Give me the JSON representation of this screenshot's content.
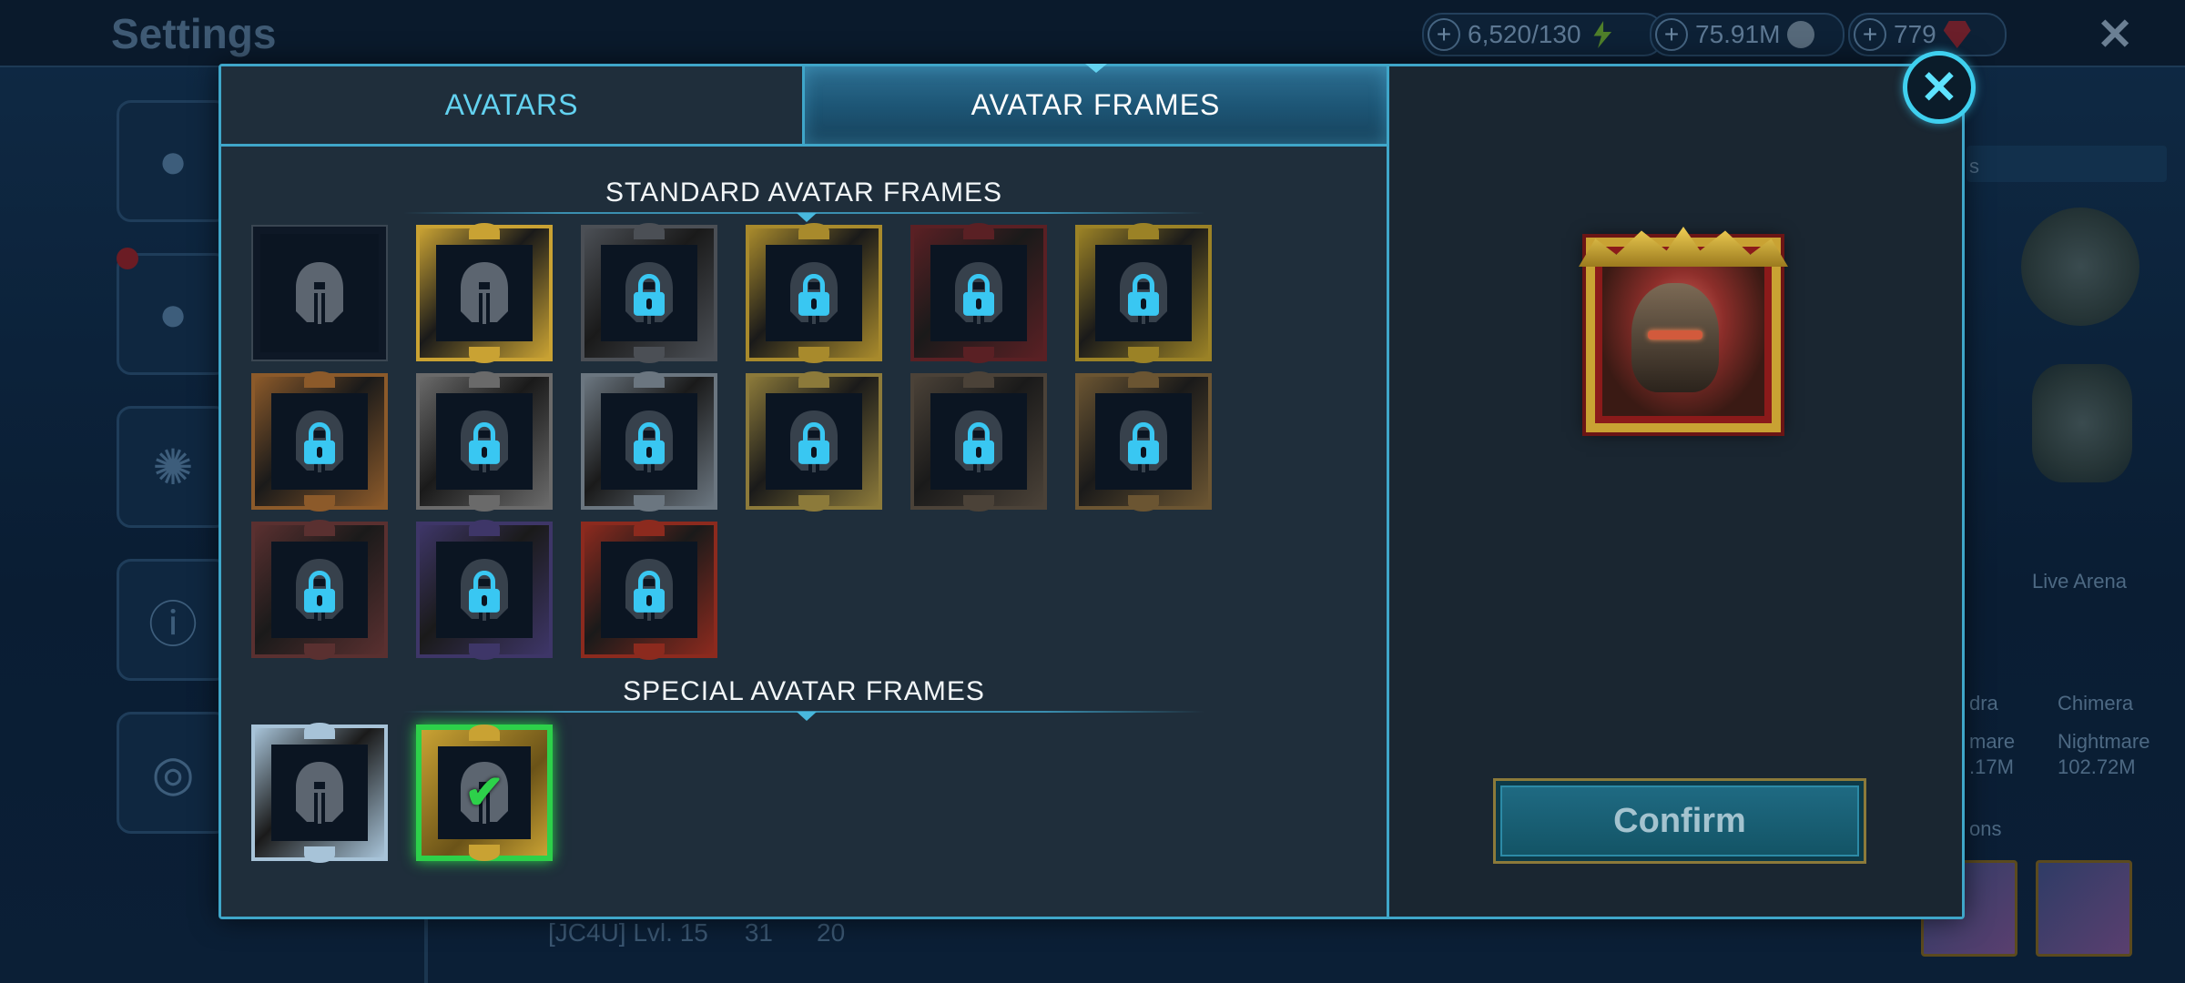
{
  "background": {
    "title": "Settings",
    "resources": [
      {
        "value": "6,520/130",
        "icon": "energy-icon",
        "color": "#6ab43c"
      },
      {
        "value": "75.91M",
        "icon": "silver-icon",
        "color": "#8aa0b4"
      },
      {
        "value": "779",
        "icon": "gem-icon",
        "color": "#c8323c"
      }
    ],
    "bottom_row": {
      "clan": "[JC4U] Lvl. 15",
      "stat1": "31",
      "stat2": "20"
    },
    "right_texts": {
      "live_arena": "Live Arena",
      "hydra": "dra",
      "chimera": "Chimera",
      "nightmare_1": "mare",
      "nightmare_2": "Nightmare",
      "score_1": ".17M",
      "score_2": "102.72M",
      "ons": "ons",
      "s": "s"
    }
  },
  "tabs": {
    "avatars": "AVATARS",
    "avatar_frames": "AVATAR FRAMES",
    "active": "avatar_frames"
  },
  "sections": {
    "standard": "STANDARD AVATAR FRAMES",
    "special": "SPECIAL AVATAR FRAMES"
  },
  "standard_frames": [
    {
      "name": "default",
      "state": "unlocked",
      "color": "#25313c"
    },
    {
      "name": "gold-serpent",
      "state": "unlocked",
      "color": "#c9a233"
    },
    {
      "name": "dark-skull",
      "state": "locked",
      "color": "#4b4f55"
    },
    {
      "name": "gold-leaf",
      "state": "locked",
      "color": "#a88a2c"
    },
    {
      "name": "red-eye",
      "state": "locked",
      "color": "#5a2024"
    },
    {
      "name": "gold-claw",
      "state": "locked",
      "color": "#9b8226"
    },
    {
      "name": "bronze-ornate",
      "state": "locked",
      "color": "#8c5a2a"
    },
    {
      "name": "red-banner",
      "state": "locked",
      "color": "#6a6a6a"
    },
    {
      "name": "silver-demon",
      "state": "locked",
      "color": "#6b7680"
    },
    {
      "name": "blue-banner",
      "state": "locked",
      "color": "#8c7a3a"
    },
    {
      "name": "chain-scroll",
      "state": "locked",
      "color": "#4b4238"
    },
    {
      "name": "bronze-horn",
      "state": "locked",
      "color": "#6b5532"
    },
    {
      "name": "dark-spiked",
      "state": "locked",
      "color": "#5a3030"
    },
    {
      "name": "purple-arch",
      "state": "locked",
      "color": "#3e3668"
    },
    {
      "name": "gold-tower",
      "state": "locked",
      "color": "#8c2a1e"
    }
  ],
  "special_frames": [
    {
      "name": "ice",
      "state": "unlocked",
      "color": "#a7c3d8"
    },
    {
      "name": "gold-laurel",
      "state": "selected",
      "color": "#c9a233"
    }
  ],
  "confirm_label": "Confirm",
  "colors": {
    "accent": "#3fa6c9",
    "lock": "#39c7f2",
    "selected": "#2dd14a"
  }
}
